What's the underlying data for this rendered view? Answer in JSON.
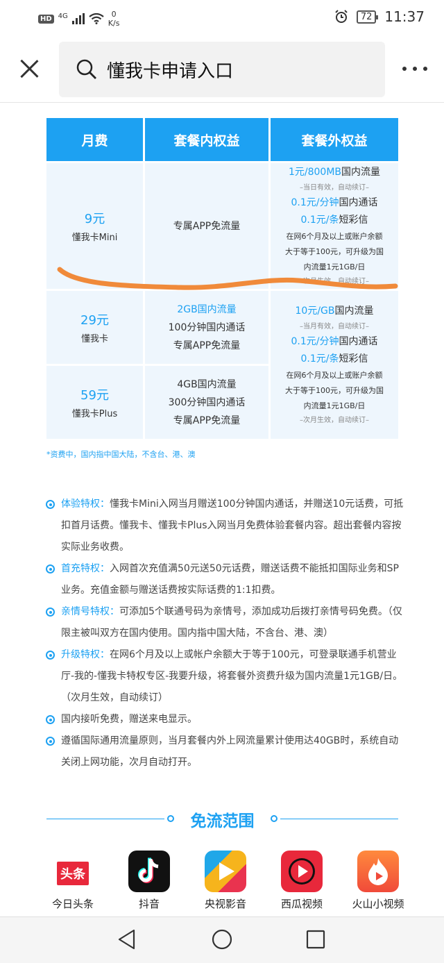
{
  "status_bar": {
    "hd": "HD",
    "network": "4G",
    "speed_value": "0",
    "speed_unit": "K/s",
    "battery": "72",
    "time": "11:37"
  },
  "search": {
    "query": "懂我卡申请入口"
  },
  "table": {
    "headers": [
      "月费",
      "套餐内权益",
      "套餐外权益"
    ],
    "rows": [
      {
        "price": "9元",
        "name": "懂我卡Mini",
        "benefits": [
          "专属APP免流量"
        ]
      },
      {
        "price": "29元",
        "name": "懂我卡",
        "benefits": [
          "2GB国内流量",
          "100分钟国内通话",
          "专属APP免流量"
        ]
      },
      {
        "price": "59元",
        "name": "懂我卡Plus",
        "benefits": [
          "4GB国内流量",
          "300分钟国内通话",
          "专属APP免流量"
        ]
      }
    ],
    "extra_mini": {
      "l1a": "1元/800MB",
      "l1b": "国内流量",
      "l2": "–当日有效，自动续订–",
      "l3a": "0.1元/分钟",
      "l3b": "国内通话",
      "l4a": "0.1元/条",
      "l4b": "短彩信",
      "l5": "在网6个月及以上或账户余额",
      "l6": "大于等于100元，可升级为国",
      "l7": "内流量1元1GB/日",
      "l8": "–次月生效，自动续订–"
    },
    "extra_std": {
      "l1a": "10元/GB",
      "l1b": "国内流量",
      "l2": "–当月有效，自动续订–",
      "l3a": "0.1元/分钟",
      "l3b": "国内通话",
      "l4a": "0.1元/条",
      "l4b": "短彩信",
      "l5": "在网6个月及以上或账户余额",
      "l6": "大于等于100元，可升级为国",
      "l7": "内流量1元1GB/日",
      "l8": "–次月生效，自动续订–"
    }
  },
  "footnote": "*资费中，国内指中国大陆，不含台、港、澳",
  "features": [
    {
      "title": "体验特权：",
      "text": "懂我卡Mini入网当月赠送100分钟国内通话，并赠送10元话费，可抵扣首月话费。懂我卡、懂我卡Plus入网当月免费体验套餐内容。超出套餐内容按实际业务收费。"
    },
    {
      "title": "首充特权：",
      "text": "入网首次充值满50元送50元话费，赠送话费不能抵扣国际业务和SP业务。充值金额与赠送话费按实际话费的1:1扣费。"
    },
    {
      "title": "亲情号特权：",
      "text": "可添加5个联通号码为亲情号，添加成功后拨打亲情号码免费。（仅限主被叫双方在国内使用。国内指中国大陆，不含台、港、澳）"
    },
    {
      "title": "升级特权：",
      "text": "在网6个月及以上或帐户余额大于等于100元，可登录联通手机营业厅-我的-懂我卡特权专区-我要升级，将套餐外资费升级为国内流量1元1GB/日。（次月生效，自动续订）"
    },
    {
      "title": "",
      "text": "国内接听免费，赠送来电显示。"
    },
    {
      "title": "",
      "text": "遵循国际通用流量原则，当月套餐内外上网流量累计使用达40GB时，系统自动关闭上网功能，次月自动打开。"
    }
  ],
  "free_range": {
    "title": "免流范围",
    "apps": [
      {
        "name": "今日头条",
        "icon_text": "头条"
      },
      {
        "name": "抖音"
      },
      {
        "name": "央视影音"
      },
      {
        "name": "西瓜视频"
      },
      {
        "name": "火山小视频"
      }
    ]
  }
}
